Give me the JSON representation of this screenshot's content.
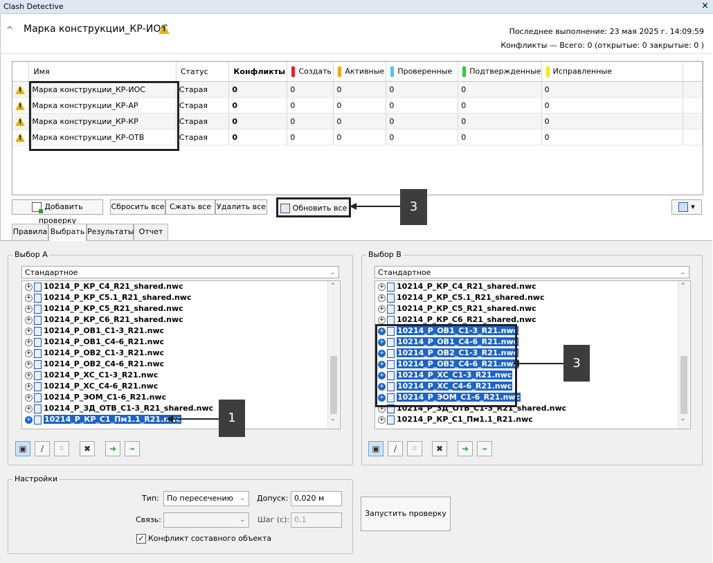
{
  "window": {
    "title": "Clash Detective",
    "close": "×"
  },
  "header": {
    "chevron": "^",
    "test_name": "Марка конструкции_КР-ИОС",
    "last_run": "Последнее выполнение:  23 мая 2025 г. 14:09:59",
    "summary": "Конфликты —  Всего:  0  (открытые:  0  закрытые:  0 )"
  },
  "grid": {
    "columns": {
      "name": "Имя",
      "status": "Статус",
      "clashes": "Конфликты",
      "new": "Создать",
      "active": "Активные",
      "reviewed": "Проверенные",
      "approved": "Подтвержденные",
      "resolved": "Исправленные"
    },
    "colors": {
      "new": "#e8202a",
      "active": "#f5a623",
      "reviewed": "#4fc3f7",
      "approved": "#2ecc40",
      "resolved": "#f5e61e"
    },
    "rows": [
      {
        "name": "Марка конструкции_КР-ИОС",
        "status": "Старая",
        "clashes": "0",
        "new": "0",
        "active": "0",
        "reviewed": "0",
        "approved": "0",
        "resolved": "0"
      },
      {
        "name": "Марка конструкции_КР-АР",
        "status": "Старая",
        "clashes": "0",
        "new": "0",
        "active": "0",
        "reviewed": "0",
        "approved": "0",
        "resolved": "0"
      },
      {
        "name": "Марка конструкции_КР-КР",
        "status": "Старая",
        "clashes": "0",
        "new": "0",
        "active": "0",
        "reviewed": "0",
        "approved": "0",
        "resolved": "0"
      },
      {
        "name": "Марка конструкции_КР-ОТВ",
        "status": "Старая",
        "clashes": "0",
        "new": "0",
        "active": "0",
        "reviewed": "0",
        "approved": "0",
        "resolved": "0"
      }
    ]
  },
  "toolbar": {
    "add_test": "Добавить проверку",
    "reset_all": "Сбросить все",
    "compact_all": "Сжать все",
    "delete_all": "Удалить все",
    "update_all": "Обновить все",
    "export_arrow": "▾"
  },
  "callouts": {
    "one": "1",
    "three_top": "3",
    "three_right": "3"
  },
  "tabs": [
    "Правила",
    "Выбрать",
    "Результаты",
    "Отчет"
  ],
  "selection_a": {
    "label": "Выбор A",
    "mode": "Стандартное",
    "items": [
      {
        "text": "10214_Р_КР_С4_R21_shared.nwc",
        "selected": false
      },
      {
        "text": "10214_Р_КР_С5.1_R21_shared.nwc",
        "selected": false
      },
      {
        "text": "10214_Р_КР_С5_R21_shared.nwc",
        "selected": false
      },
      {
        "text": "10214_Р_КР_С6_R21_shared.nwc",
        "selected": false
      },
      {
        "text": "10214_Р_ОВ1_С1-3_R21.nwc",
        "selected": false
      },
      {
        "text": "10214_Р_ОВ1_С4-6_R21.nwc",
        "selected": false
      },
      {
        "text": "10214_Р_ОВ2_С1-3_R21.nwc",
        "selected": false
      },
      {
        "text": "10214_Р_ОВ2_С4-6_R21.nwc",
        "selected": false
      },
      {
        "text": "10214_Р_ХС_С1-3_R21.nwc",
        "selected": false
      },
      {
        "text": "10214_Р_ХС_С4-6_R21.nwc",
        "selected": false
      },
      {
        "text": "10214_Р_ЭОМ_С1-6_R21.nwc",
        "selected": false
      },
      {
        "text": "10214_Р_ЗД_ОТВ_С1-3_R21_shared.nwc",
        "selected": false
      },
      {
        "text": "10214_Р_КР_С1_Пм1.1_R21.nwc",
        "selected": true
      }
    ]
  },
  "selection_b": {
    "label": "Выбор B",
    "mode": "Стандартное",
    "items": [
      {
        "text": "10214_Р_КР_С4_R21_shared.nwc",
        "selected": false
      },
      {
        "text": "10214_Р_КР_С5.1_R21_shared.nwc",
        "selected": false
      },
      {
        "text": "10214_Р_КР_С5_R21_shared.nwc",
        "selected": false
      },
      {
        "text": "10214_Р_КР_С6_R21_shared.nwc",
        "selected": false
      },
      {
        "text": "10214_Р_ОВ1_С1-3_R21.nwc",
        "selected": true
      },
      {
        "text": "10214_Р_ОВ1_С4-6_R21.nwc",
        "selected": true
      },
      {
        "text": "10214_Р_ОВ2_С1-3_R21.nwc",
        "selected": true
      },
      {
        "text": "10214_Р_ОВ2_С4-6_R21.nwc",
        "selected": true
      },
      {
        "text": "10214_Р_ХС_С1-3_R21.nwc",
        "selected": true
      },
      {
        "text": "10214_Р_ХС_С4-6_R21.nwc",
        "selected": true
      },
      {
        "text": "10214_Р_ЭОМ_С1-6_R21.nwc",
        "selected": true
      },
      {
        "text": "10214_Р_ЗД_ОТВ_С1-3_R21_shared.nwc",
        "selected": false
      },
      {
        "text": "10214_Р_КР_С1_Пм1.1_R21.nwc",
        "selected": false
      }
    ]
  },
  "settings": {
    "label": "Настройки",
    "type_label": "Тип:",
    "type_value": "По пересечению",
    "tolerance_label": "Допуск:",
    "tolerance_value": "0,020 м",
    "link_label": "Связь:",
    "link_value": "",
    "step_label": "Шаг (с):",
    "step_value": "0,1",
    "composite_label": "Конфликт составного объекта",
    "composite_checked": true
  },
  "run_button": "Запустить проверку"
}
